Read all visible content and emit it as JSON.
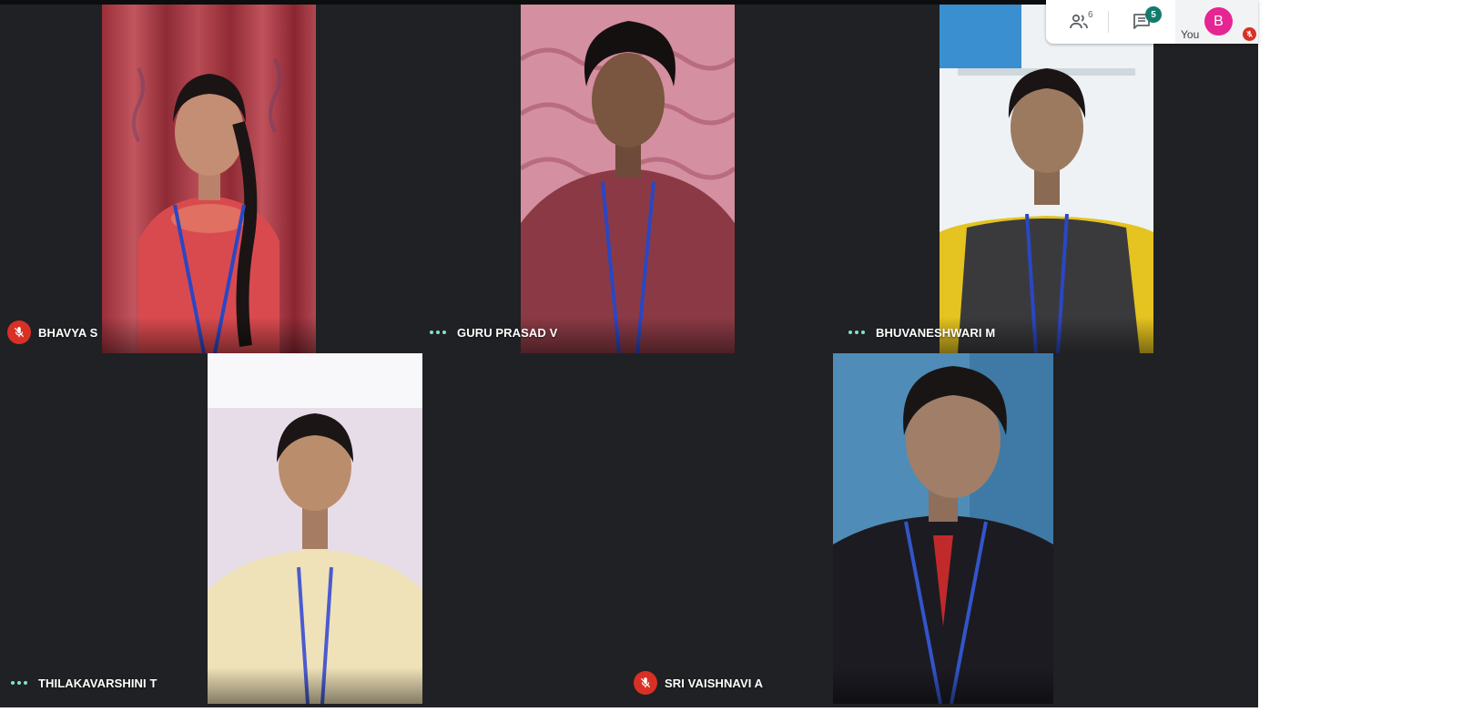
{
  "controls": {
    "participants_icon": "people-icon",
    "participants_count": "6",
    "chat_icon": "chat-icon",
    "chat_badge": "5",
    "self_avatar_letter": "B",
    "self_avatar_color": "#e52592",
    "self_label": "You",
    "self_muted": true
  },
  "participants": [
    {
      "name": "BHAVYA S",
      "status": "muted",
      "status_color": "#d93025"
    },
    {
      "name": "GURU PRASAD V",
      "status": "speaking-dots",
      "status_color": "#81e3c8"
    },
    {
      "name": "BHUVANESHWARI M",
      "status": "speaking-dots",
      "status_color": "#81e3c8"
    },
    {
      "name": "THILAKAVARSHINI T",
      "status": "speaking-dots",
      "status_color": "#81e3c8"
    },
    {
      "name": "SRI VAISHNAVI A",
      "status": "muted",
      "status_color": "#d93025"
    }
  ],
  "colors": {
    "stage_background": "#202124",
    "mute_red": "#d93025",
    "chat_badge": "#137a6e"
  }
}
